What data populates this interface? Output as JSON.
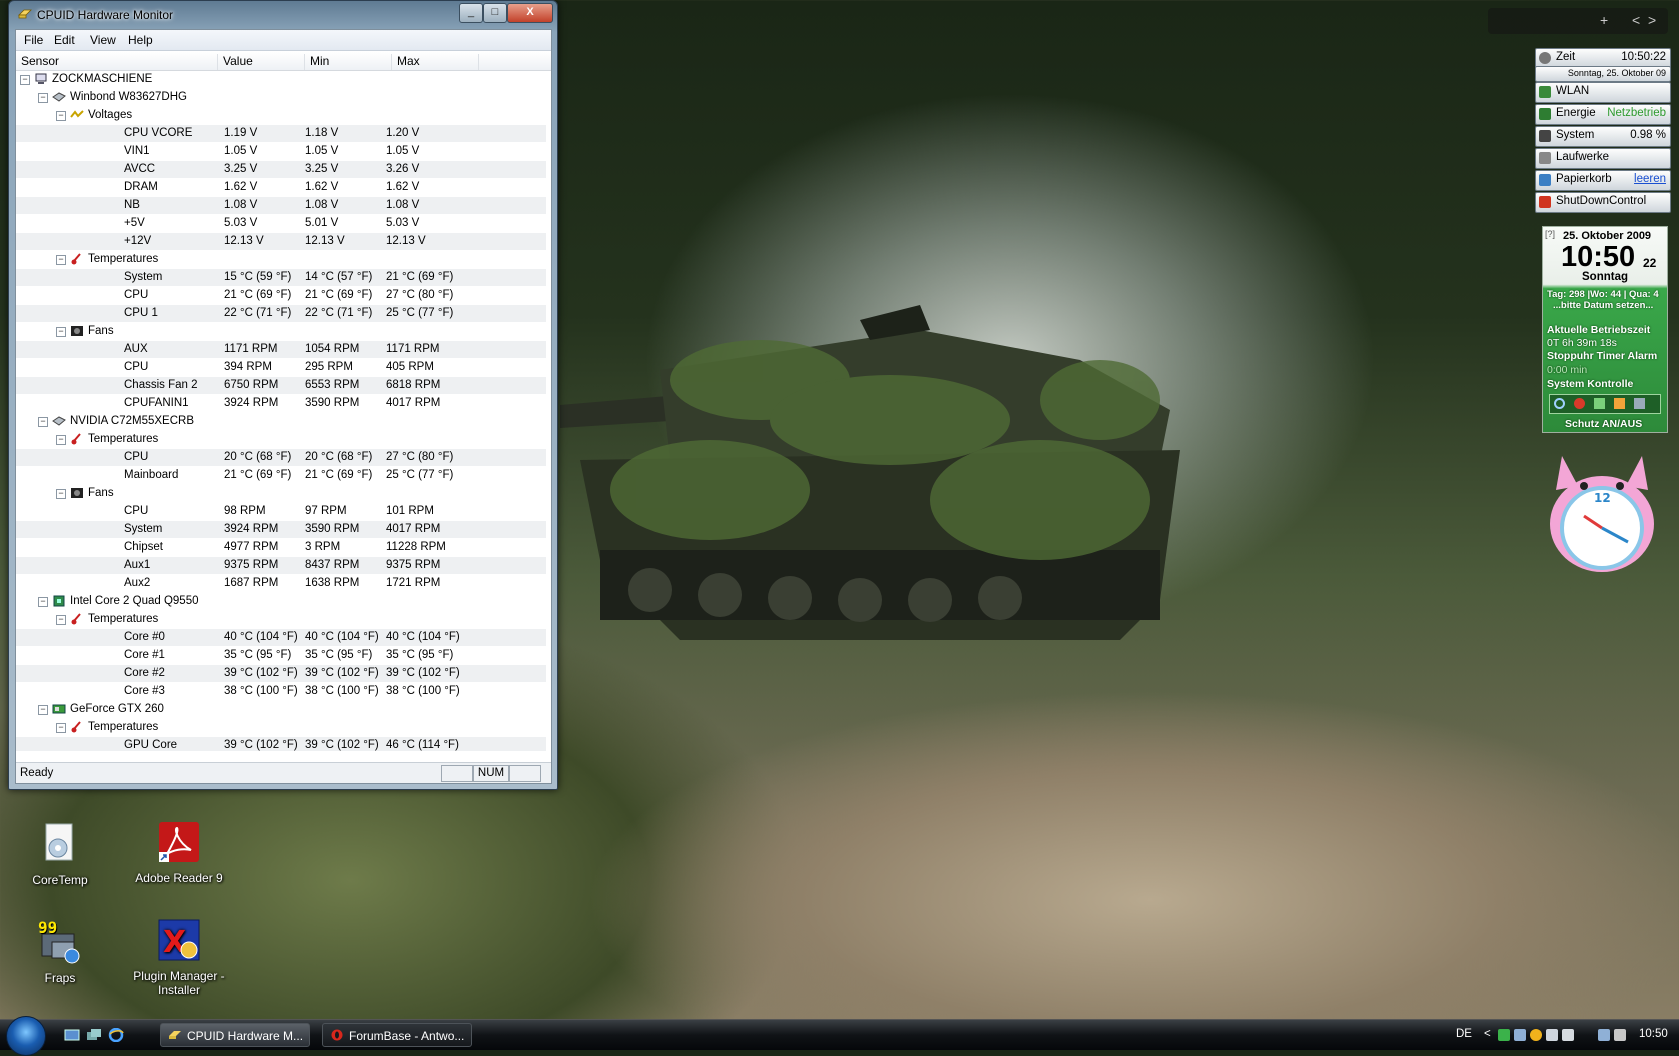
{
  "window": {
    "title": "CPUID Hardware Monitor",
    "controls": {
      "minimize": "_",
      "maximize": "□",
      "close": "X"
    }
  },
  "menu": [
    "File",
    "Edit",
    "View",
    "Help"
  ],
  "columns": [
    "Sensor",
    "Value",
    "Min",
    "Max"
  ],
  "tree": [
    {
      "level": 0,
      "label": "ZOCKMASCHIENE",
      "icon": "computer-icon",
      "toggle": "−"
    },
    {
      "level": 1,
      "label": "Winbond W83627DHG",
      "icon": "chip-icon",
      "toggle": "−"
    },
    {
      "level": 2,
      "label": "Voltages",
      "icon": "voltage-icon",
      "toggle": "−"
    },
    {
      "level": 3,
      "label": "CPU VCORE",
      "value": "1.19 V",
      "min": "1.18 V",
      "max": "1.20 V"
    },
    {
      "level": 3,
      "label": "VIN1",
      "value": "1.05 V",
      "min": "1.05 V",
      "max": "1.05 V"
    },
    {
      "level": 3,
      "label": "AVCC",
      "value": "3.25 V",
      "min": "3.25 V",
      "max": "3.26 V"
    },
    {
      "level": 3,
      "label": "DRAM",
      "value": "1.62 V",
      "min": "1.62 V",
      "max": "1.62 V"
    },
    {
      "level": 3,
      "label": "NB",
      "value": "1.08 V",
      "min": "1.08 V",
      "max": "1.08 V"
    },
    {
      "level": 3,
      "label": "+5V",
      "value": "5.03 V",
      "min": "5.01 V",
      "max": "5.03 V"
    },
    {
      "level": 3,
      "label": "+12V",
      "value": "12.13 V",
      "min": "12.13 V",
      "max": "12.13 V"
    },
    {
      "level": 2,
      "label": "Temperatures",
      "icon": "thermometer-icon",
      "toggle": "−"
    },
    {
      "level": 3,
      "label": "System",
      "value": "15 °C  (59 °F)",
      "min": "14 °C  (57 °F)",
      "max": "21 °C  (69 °F)"
    },
    {
      "level": 3,
      "label": "CPU",
      "value": "21 °C  (69 °F)",
      "min": "21 °C  (69 °F)",
      "max": "27 °C  (80 °F)"
    },
    {
      "level": 3,
      "label": "CPU 1",
      "value": "22 °C  (71 °F)",
      "min": "22 °C  (71 °F)",
      "max": "25 °C  (77 °F)"
    },
    {
      "level": 2,
      "label": "Fans",
      "icon": "fan-icon",
      "toggle": "−"
    },
    {
      "level": 3,
      "label": "AUX",
      "value": "1171 RPM",
      "min": "1054 RPM",
      "max": "1171 RPM"
    },
    {
      "level": 3,
      "label": "CPU",
      "value": "394 RPM",
      "min": "295 RPM",
      "max": "405 RPM"
    },
    {
      "level": 3,
      "label": "Chassis Fan 2",
      "value": "6750 RPM",
      "min": "6553 RPM",
      "max": "6818 RPM"
    },
    {
      "level": 3,
      "label": "CPUFANIN1",
      "value": "3924 RPM",
      "min": "3590 RPM",
      "max": "4017 RPM"
    },
    {
      "level": 1,
      "label": "NVIDIA C72M55XECRB",
      "icon": "chip-icon",
      "toggle": "−"
    },
    {
      "level": 2,
      "label": "Temperatures",
      "icon": "thermometer-icon",
      "toggle": "−"
    },
    {
      "level": 3,
      "label": "CPU",
      "value": "20 °C  (68 °F)",
      "min": "20 °C  (68 °F)",
      "max": "27 °C  (80 °F)"
    },
    {
      "level": 3,
      "label": "Mainboard",
      "value": "21 °C  (69 °F)",
      "min": "21 °C  (69 °F)",
      "max": "25 °C  (77 °F)"
    },
    {
      "level": 2,
      "label": "Fans",
      "icon": "fan-icon",
      "toggle": "−"
    },
    {
      "level": 3,
      "label": "CPU",
      "value": "98 RPM",
      "min": "97 RPM",
      "max": "101 RPM"
    },
    {
      "level": 3,
      "label": "System",
      "value": "3924 RPM",
      "min": "3590 RPM",
      "max": "4017 RPM"
    },
    {
      "level": 3,
      "label": "Chipset",
      "value": "4977 RPM",
      "min": "3 RPM",
      "max": "11228 RPM"
    },
    {
      "level": 3,
      "label": "Aux1",
      "value": "9375 RPM",
      "min": "8437 RPM",
      "max": "9375 RPM"
    },
    {
      "level": 3,
      "label": "Aux2",
      "value": "1687 RPM",
      "min": "1638 RPM",
      "max": "1721 RPM"
    },
    {
      "level": 1,
      "label": "Intel Core 2 Quad Q9550",
      "icon": "cpu-icon",
      "toggle": "−"
    },
    {
      "level": 2,
      "label": "Temperatures",
      "icon": "thermometer-icon",
      "toggle": "−"
    },
    {
      "level": 3,
      "label": "Core #0",
      "value": "40 °C  (104 °F)",
      "min": "40 °C  (104 °F)",
      "max": "40 °C  (104 °F)"
    },
    {
      "level": 3,
      "label": "Core #1",
      "value": "35 °C  (95 °F)",
      "min": "35 °C  (95 °F)",
      "max": "35 °C  (95 °F)"
    },
    {
      "level": 3,
      "label": "Core #2",
      "value": "39 °C  (102 °F)",
      "min": "39 °C  (102 °F)",
      "max": "39 °C  (102 °F)"
    },
    {
      "level": 3,
      "label": "Core #3",
      "value": "38 °C  (100 °F)",
      "min": "38 °C  (100 °F)",
      "max": "38 °C  (100 °F)"
    },
    {
      "level": 1,
      "label": "GeForce GTX 260",
      "icon": "gpu-icon",
      "toggle": "−"
    },
    {
      "level": 2,
      "label": "Temperatures",
      "icon": "thermometer-icon",
      "toggle": "−"
    },
    {
      "level": 3,
      "label": "GPU Core",
      "value": "39 °C  (102 °F)",
      "min": "39 °C  (102 °F)",
      "max": "46 °C  (114 °F)"
    }
  ],
  "status": {
    "text": "Ready",
    "num": "NUM"
  },
  "desktop_icons": [
    {
      "label": "CoreTemp",
      "icon": "coretemp-icon"
    },
    {
      "label": "Adobe Reader 9",
      "icon": "adobe-reader-icon"
    },
    {
      "label": "Fraps",
      "icon": "fraps-icon",
      "badge": "99"
    },
    {
      "label": "Plugin Manager - Installer",
      "icon": "plugin-manager-icon"
    }
  ],
  "sidebar_gadget": {
    "controls": [
      "+",
      "<",
      ">"
    ],
    "zeit_label": "Zeit",
    "zeit_value": "10:50:22",
    "date_line": "Sonntag, 25. Oktober 09",
    "items": [
      {
        "label": "WLAN",
        "right": "",
        "icon_color": "#3a8a3a"
      },
      {
        "label": "Energie",
        "right": "Netzbetrieb",
        "icon_color": "#2e7d32",
        "right_color": "#2e9b2e"
      },
      {
        "label": "System",
        "right": "0.98 %",
        "icon_color": "#444444"
      },
      {
        "label": "Laufwerke",
        "right": "",
        "icon_color": "#888888"
      },
      {
        "label": "Papierkorb",
        "right": "leeren",
        "icon_color": "#3b7fc4",
        "right_color": "#1a4fd0"
      },
      {
        "label": "ShutDownControl",
        "right": "",
        "icon_color": "#d0341f"
      }
    ]
  },
  "calendar_gadget": {
    "corner": "[?]",
    "date": "25. Oktober 2009",
    "time": "10:50",
    "seconds": "22",
    "weekday": "Sonntag",
    "info": "Tag: 298 |Wo: 44 | Qua: 4",
    "hint": "...bitte Datum setzen...",
    "uptime_label": "Aktuelle Betriebszeit",
    "uptime": "0T 6h 39m 18s",
    "timers": "Stoppuhr Timer Alarm",
    "timer_value": "0:00 min",
    "control": "System Kontrolle",
    "protect": "Schutz AN/AUS"
  },
  "clock_gadget": {
    "numeral": "12"
  },
  "taskbar": {
    "buttons": [
      {
        "label": "CPUID Hardware M...",
        "active": true
      },
      {
        "label": "ForumBase - Antwo...",
        "active": false
      }
    ],
    "lang": "DE",
    "chevron": "<",
    "time": "10:50"
  }
}
